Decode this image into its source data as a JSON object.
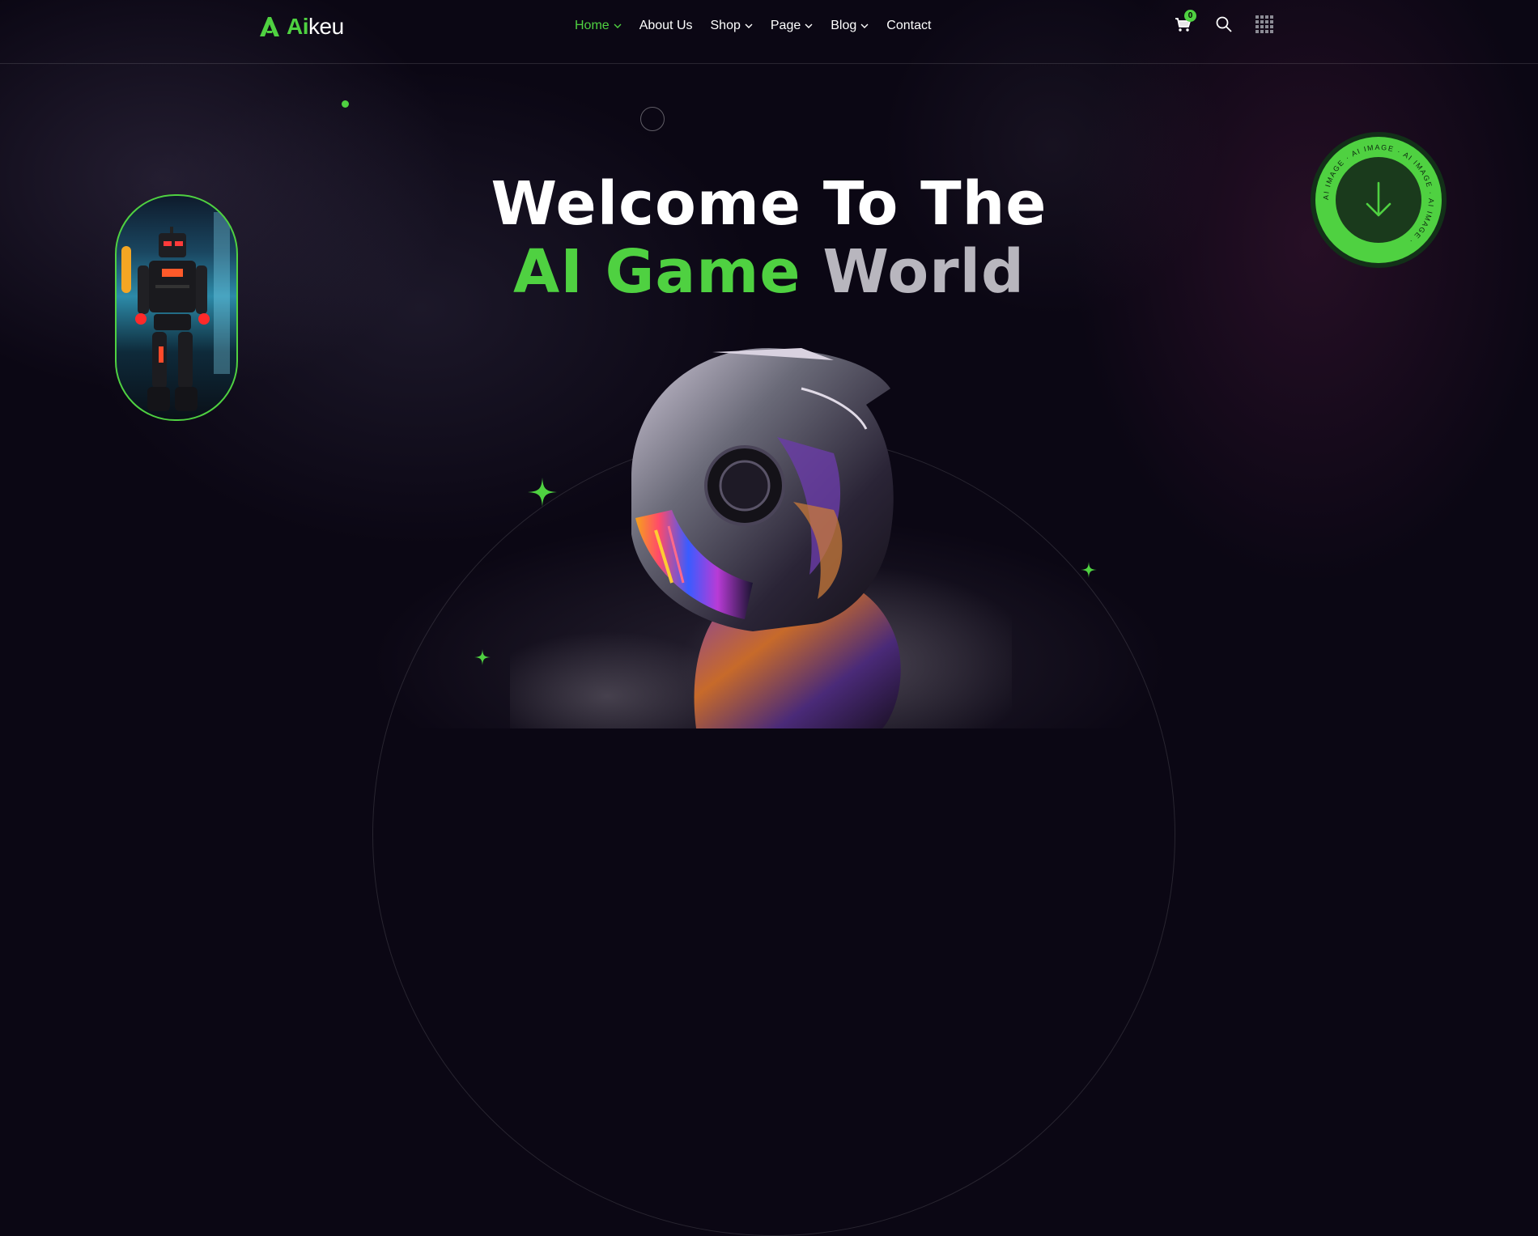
{
  "logo": {
    "accent": "Ai",
    "rest": "keu"
  },
  "nav": {
    "items": [
      {
        "label": "Home",
        "active": true,
        "dropdown": true
      },
      {
        "label": "About Us",
        "active": false,
        "dropdown": false
      },
      {
        "label": "Shop",
        "active": false,
        "dropdown": true
      },
      {
        "label": "Page",
        "active": false,
        "dropdown": true
      },
      {
        "label": "Blog",
        "active": false,
        "dropdown": true
      },
      {
        "label": "Contact",
        "active": false,
        "dropdown": false
      }
    ]
  },
  "header_icons": {
    "cart_count": "0",
    "cart_icon": "cart-icon",
    "search_icon": "search-icon",
    "menu_icon": "grid-menu-icon"
  },
  "hero": {
    "line1": "Welcome To The",
    "line2_green": "AI Game",
    "line2_white": "World"
  },
  "badge": {
    "ring_text": "AI IMAGE · AI IMAGE · AI IMAGE · AI IMAGE ·",
    "icon": "arrow-down-icon"
  },
  "colors": {
    "accent": "#4fd141",
    "background": "#0b0714",
    "muted_text": "#b8b6be"
  }
}
